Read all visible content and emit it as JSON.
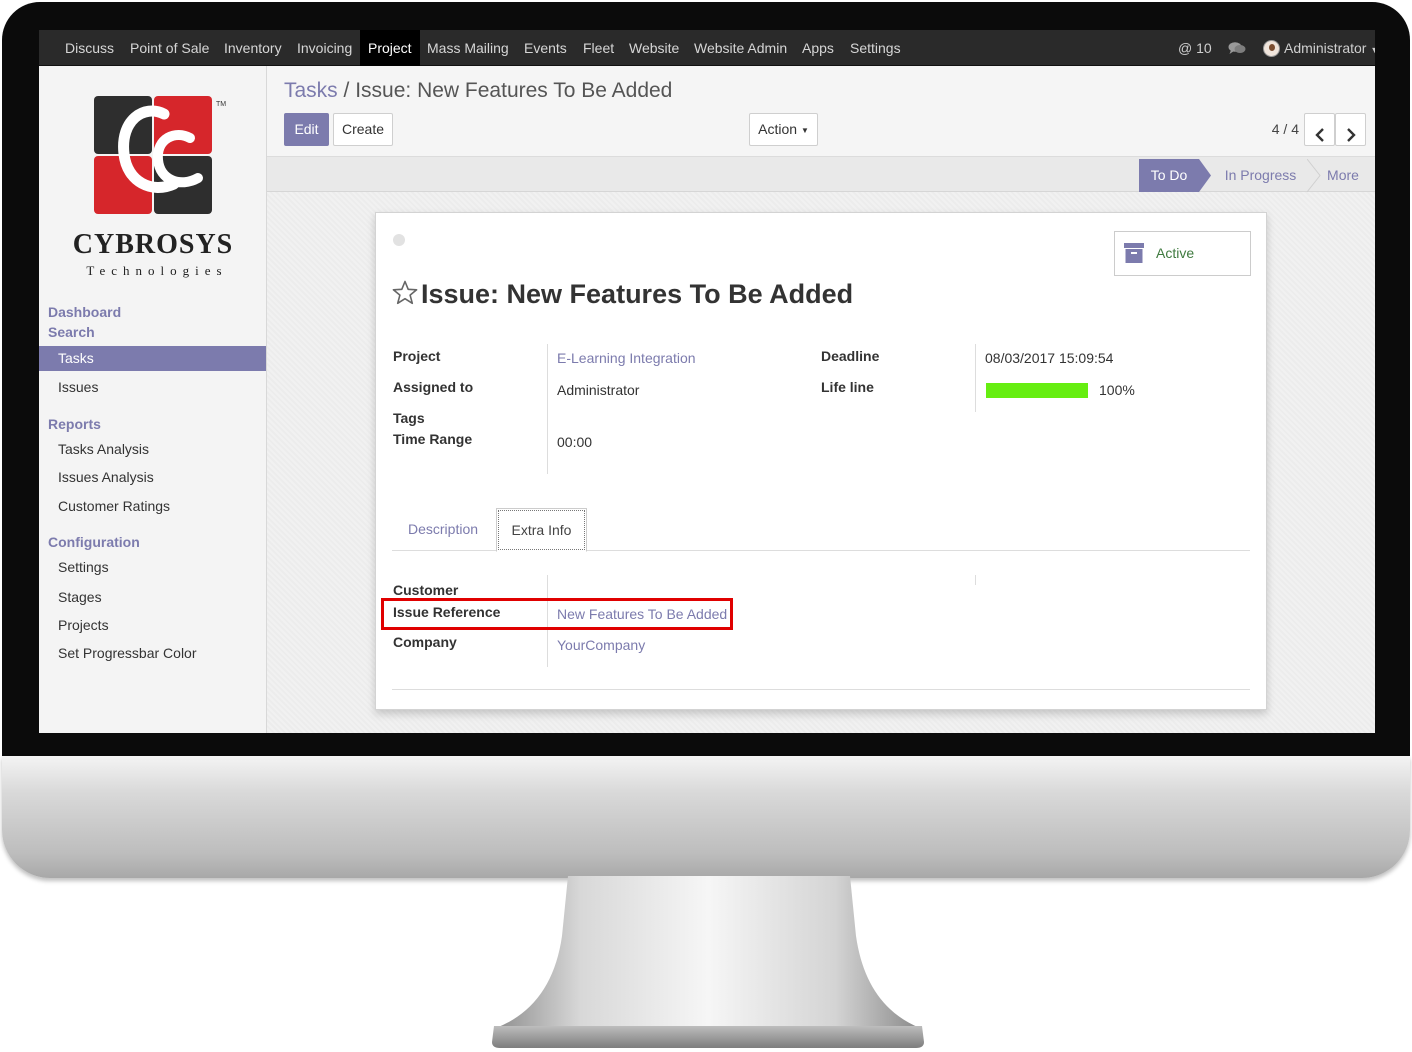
{
  "nav": {
    "menu": [
      "Discuss",
      "Point of Sale",
      "Inventory",
      "Invoicing",
      "Project",
      "Mass Mailing",
      "Events",
      "Fleet",
      "Website",
      "Website Admin",
      "Apps",
      "Settings"
    ],
    "active": "Project",
    "mentions": "@ 10",
    "user": "Administrator"
  },
  "logo": {
    "name": "CYBROSYS",
    "tagline": "Technologies",
    "tm": "TM"
  },
  "sidebar": {
    "dashboard": "Dashboard",
    "search": "Search",
    "search_items": [
      "Tasks",
      "Issues"
    ],
    "reports": "Reports",
    "report_items": [
      "Tasks Analysis",
      "Issues Analysis",
      "Customer Ratings"
    ],
    "configuration": "Configuration",
    "config_items": [
      "Settings",
      "Stages",
      "Projects",
      "Set Progressbar Color"
    ]
  },
  "breadcrumb": {
    "parent": "Tasks",
    "separator": "/",
    "current": "Issue: New Features To Be Added"
  },
  "toolbar": {
    "edit": "Edit",
    "create": "Create",
    "action": "Action"
  },
  "pager": {
    "text": "4 / 4"
  },
  "stages": [
    "To Do",
    "In Progress",
    "More"
  ],
  "record": {
    "active_label": "Active",
    "title": "Issue: New Features To Be Added",
    "fields": {
      "project_label": "Project",
      "project_value": "E-Learning Integration",
      "assigned_label": "Assigned to",
      "assigned_value": "Administrator",
      "tags_label": "Tags",
      "time_range_label": "Time Range",
      "time_range_value": "00:00",
      "deadline_label": "Deadline",
      "deadline_value": "08/03/2017 15:09:54",
      "lifeline_label": "Life line",
      "lifeline_value": "100%",
      "lifeline_fraction": 1.0
    },
    "tabs": [
      "Description",
      "Extra Info"
    ],
    "extra": {
      "customer_label": "Customer",
      "issue_ref_label": "Issue Reference",
      "issue_ref_value": "New Features To Be Added",
      "company_label": "Company",
      "company_value": "YourCompany"
    }
  },
  "colors": {
    "brand": "#7c7bad",
    "highlight": "#e00000",
    "progress": "#66ee11",
    "navbar": "#2a2a2a"
  }
}
